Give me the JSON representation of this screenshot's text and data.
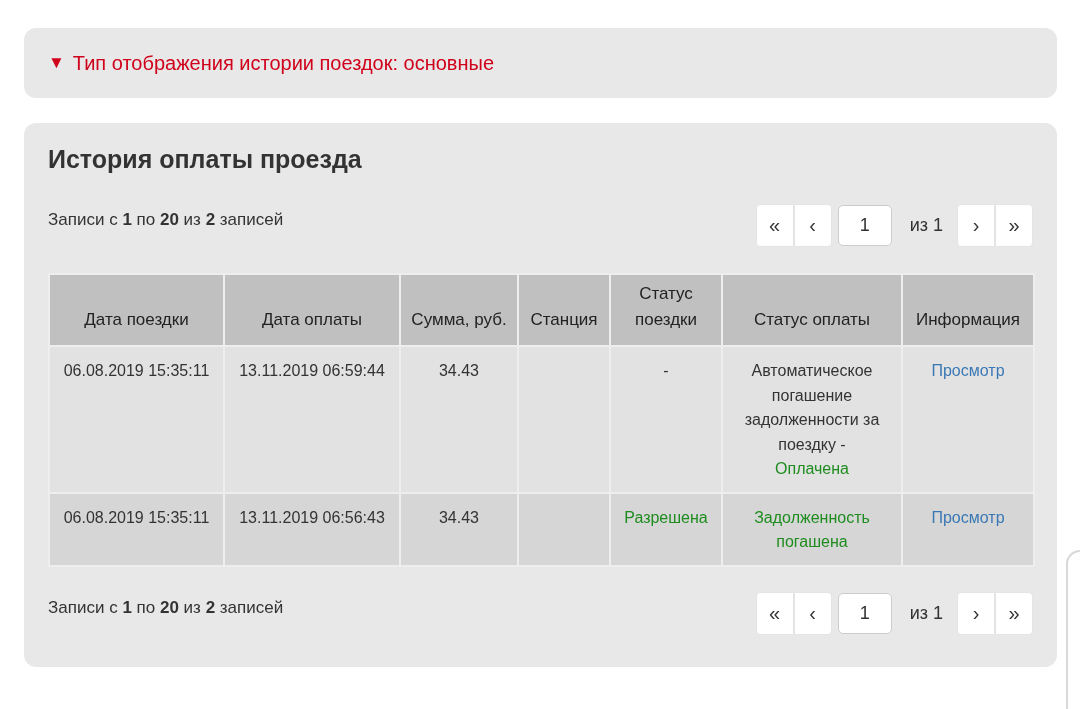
{
  "filter_panel": {
    "arrow": "▼",
    "label": "Тип отображения истории поездок: основные",
    "expanded": true
  },
  "history": {
    "title": "История оплаты проезда",
    "pagers": [
      {
        "info": "Записи с **1** по **20** из **2** записей",
        "buttons_before": [
          "«",
          "‹"
        ],
        "page": "1",
        "total": "из 1",
        "buttons_after": [
          "›",
          "»"
        ]
      },
      {
        "info": "Записи с **1** по **20** из **2** записей",
        "buttons_before": [
          "«",
          "‹"
        ],
        "page": "1",
        "total": "из 1",
        "buttons_after": [
          "›",
          "»"
        ]
      }
    ],
    "table": {
      "columns": [
        "Дата поездки",
        "Дата оплаты",
        "Сумма, руб.",
        "Станция",
        "Статус поездки",
        "Статус оплаты",
        "Информация"
      ],
      "rows": [
        {
          "trip_date": "06.08.2019 15:35:11",
          "pay_date": "13.11.2019 06:59:44",
          "amount": "34.43",
          "station": "",
          "trip_status": {
            "text": "-",
            "kind": "plain"
          },
          "pay_status": [
            {
              "text": "Автоматическое погашение задолженности за поездку -",
              "kind": "plain"
            },
            {
              "text": "Оплачена",
              "kind": "ok"
            }
          ],
          "link": "Просмотр"
        },
        {
          "trip_date": "06.08.2019 15:35:11",
          "pay_date": "13.11.2019 06:56:43",
          "amount": "34.43",
          "station": "",
          "trip_status": {
            "text": "Разрешена",
            "kind": "ok"
          },
          "pay_status": [
            {
              "text": "Задолженность погашена",
              "kind": "ok"
            }
          ],
          "link": "Просмотр"
        }
      ]
    }
  }
}
